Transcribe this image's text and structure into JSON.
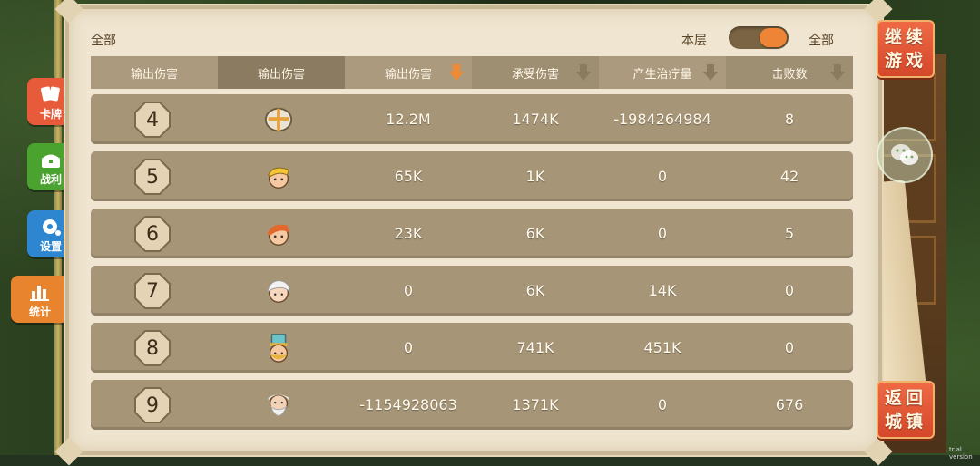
{
  "filters": {
    "left_label": "全部",
    "toggle_left": "本层",
    "toggle_right": "全部"
  },
  "columns": [
    {
      "label": "输出伤害",
      "sort": "none"
    },
    {
      "label": "输出伤害",
      "sort": "none"
    },
    {
      "label": "输出伤害",
      "sort": "desc-active"
    },
    {
      "label": "承受伤害",
      "sort": "desc"
    },
    {
      "label": "产生治疗量",
      "sort": "desc"
    },
    {
      "label": "击败数",
      "sort": "desc"
    }
  ],
  "rows": [
    {
      "rank": "4",
      "avatar": "knight-helmet-icon",
      "damage": "12.2M",
      "taken": "1474K",
      "healing": "-1984264984",
      "kills": "8"
    },
    {
      "rank": "5",
      "avatar": "blonde-hero-icon",
      "damage": "65K",
      "taken": "1K",
      "healing": "0",
      "kills": "42"
    },
    {
      "rank": "6",
      "avatar": "red-hair-hero-icon",
      "damage": "23K",
      "taken": "6K",
      "healing": "0",
      "kills": "5"
    },
    {
      "rank": "7",
      "avatar": "white-hair-hero-icon",
      "damage": "0",
      "taken": "6K",
      "healing": "14K",
      "kills": "0"
    },
    {
      "rank": "8",
      "avatar": "priest-hat-hero-icon",
      "damage": "0",
      "taken": "741K",
      "healing": "451K",
      "kills": "0"
    },
    {
      "rank": "9",
      "avatar": "elder-sage-icon",
      "damage": "-1154928063",
      "taken": "1371K",
      "healing": "0",
      "kills": "676"
    }
  ],
  "sidebar": [
    {
      "label": "卡牌",
      "icon": "cards-icon",
      "color": "#e85b3a"
    },
    {
      "label": "战利",
      "icon": "treasure-chest-icon",
      "color": "#4aa32e"
    },
    {
      "label": "设置",
      "icon": "gear-icon",
      "color": "#2e86d1"
    },
    {
      "label": "统计",
      "icon": "bar-chart-icon",
      "color": "#e8842e"
    }
  ],
  "right_buttons": {
    "continue": "继续游戏",
    "return": "返回城镇"
  },
  "watermark": "trial version"
}
